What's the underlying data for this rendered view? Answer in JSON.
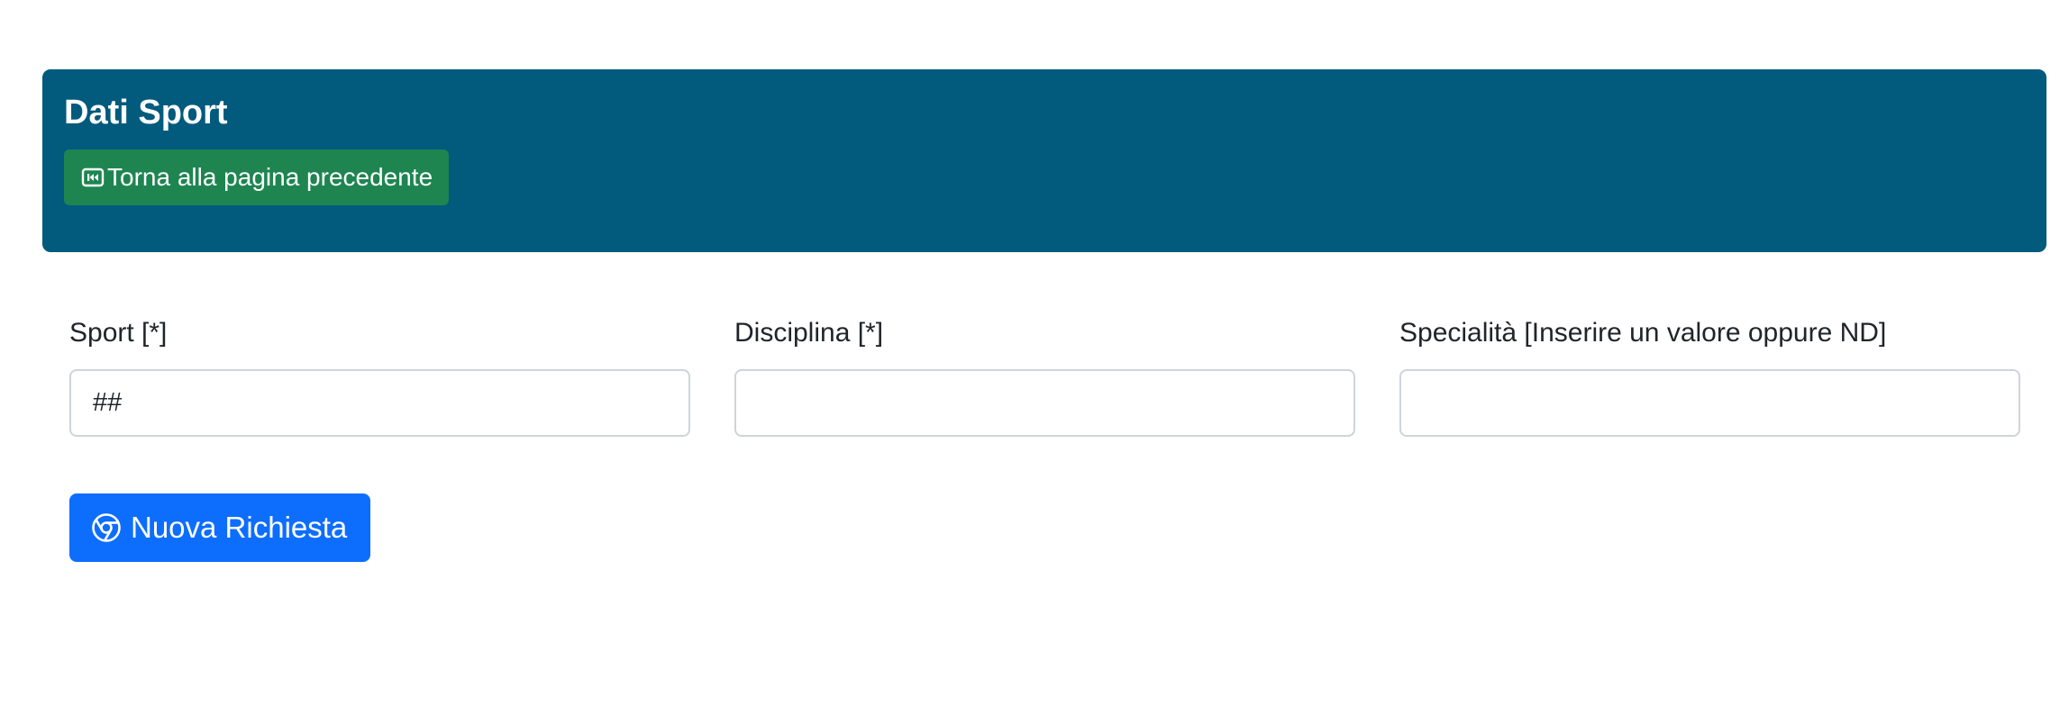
{
  "header": {
    "title": "Dati Sport",
    "back_button_label": "Torna alla pagina precedente",
    "background_color": "#025a7d",
    "back_button_color": "#1e8551",
    "back_icon": "skip-backward-icon"
  },
  "form": {
    "fields": [
      {
        "label": "Sport [*]",
        "value": "##",
        "placeholder": ""
      },
      {
        "label": "Disciplina [*]",
        "value": "",
        "placeholder": ""
      },
      {
        "label": "Specialità [Inserire un valore oppure ND]",
        "value": "",
        "placeholder": ""
      }
    ],
    "submit_label": "Nuova Richiesta",
    "submit_icon": "chrome-icon",
    "submit_color": "#0d6efd"
  }
}
